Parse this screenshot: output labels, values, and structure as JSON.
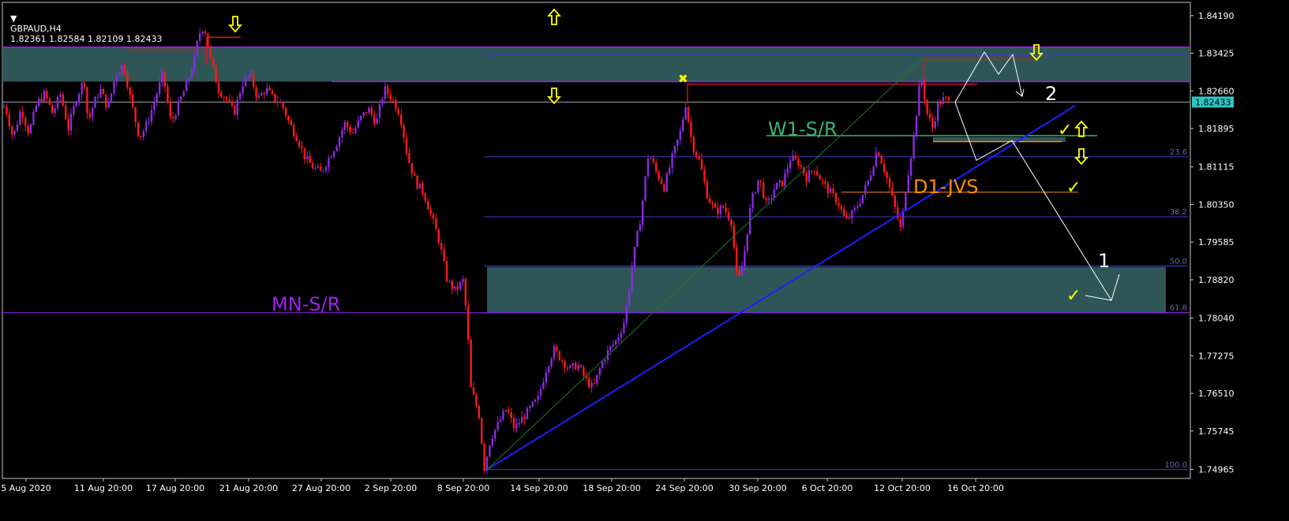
{
  "header": {
    "symbol_tf": "GBPAUD,H4",
    "ohlc": "1.82361 1.82584 1.82109 1.82433"
  },
  "colors": {
    "background": "#000000",
    "axis": "#c8c8c8",
    "bull_candle": "#8a2be2",
    "bear_candle": "#ff1a1a",
    "zone_fill": "#2f5656",
    "trendline": "#1e1eff",
    "fib_line": "#3d3dcc",
    "mn_line": "#a020f0",
    "w1_line": "#3cb371",
    "d1_line": "#ff8c00",
    "resistance_red": "#e01010",
    "arrows": "#ffff00",
    "projection": "#ffffff"
  },
  "chart_data": {
    "type": "candlestick",
    "symbol": "GBPAUD",
    "timeframe": "H4",
    "current_price": 1.82433,
    "ylim": [
      1.7478,
      1.8446
    ],
    "y_ticks": [
      "1.84190",
      "1.83425",
      "1.82660",
      "1.81895",
      "1.81115",
      "1.80350",
      "1.79585",
      "1.78820",
      "1.78040",
      "1.77275",
      "1.76510",
      "1.75745",
      "1.74965"
    ],
    "x_ticks": [
      "5 Aug 2020",
      "11 Aug 20:00",
      "17 Aug 20:00",
      "21 Aug 20:00",
      "27 Aug 20:00",
      "2 Sep 20:00",
      "8 Sep 20:00",
      "14 Sep 20:00",
      "18 Sep 20:00",
      "24 Sep 20:00",
      "30 Sep 20:00",
      "6 Oct 20:00",
      "12 Oct 20:00",
      "16 Oct 20:00"
    ],
    "price_path": [
      [
        0,
        1.823
      ],
      [
        10,
        1.8235
      ],
      [
        20,
        1.817
      ],
      [
        30,
        1.823
      ],
      [
        40,
        1.818
      ],
      [
        50,
        1.824
      ],
      [
        60,
        1.826
      ],
      [
        70,
        1.822
      ],
      [
        80,
        1.826
      ],
      [
        90,
        1.819
      ],
      [
        100,
        1.825
      ],
      [
        110,
        1.829
      ],
      [
        115,
        1.82
      ],
      [
        120,
        1.823
      ],
      [
        130,
        1.827
      ],
      [
        140,
        1.823
      ],
      [
        150,
        1.83
      ],
      [
        160,
        1.832
      ],
      [
        170,
        1.824
      ],
      [
        180,
        1.817
      ],
      [
        190,
        1.82
      ],
      [
        200,
        1.825
      ],
      [
        210,
        1.83
      ],
      [
        220,
        1.82
      ],
      [
        230,
        1.824
      ],
      [
        240,
        1.828
      ],
      [
        250,
        1.833
      ],
      [
        255,
        1.838
      ],
      [
        262,
        1.84
      ],
      [
        270,
        1.833
      ],
      [
        280,
        1.827
      ],
      [
        290,
        1.825
      ],
      [
        300,
        1.822
      ],
      [
        310,
        1.828
      ],
      [
        320,
        1.83
      ],
      [
        330,
        1.825
      ],
      [
        340,
        1.827
      ],
      [
        350,
        1.825
      ],
      [
        360,
        1.824
      ],
      [
        370,
        1.82
      ],
      [
        380,
        1.817
      ],
      [
        390,
        1.813
      ],
      [
        400,
        1.811
      ],
      [
        410,
        1.81
      ],
      [
        420,
        1.813
      ],
      [
        430,
        1.816
      ],
      [
        440,
        1.82
      ],
      [
        450,
        1.818
      ],
      [
        460,
        1.821
      ],
      [
        470,
        1.823
      ],
      [
        480,
        1.82
      ],
      [
        490,
        1.827
      ],
      [
        500,
        1.825
      ],
      [
        510,
        1.822
      ],
      [
        520,
        1.813
      ],
      [
        530,
        1.808
      ],
      [
        540,
        1.806
      ],
      [
        550,
        1.801
      ],
      [
        560,
        1.796
      ],
      [
        570,
        1.788
      ],
      [
        580,
        1.786
      ],
      [
        590,
        1.788
      ],
      [
        595,
        1.78
      ],
      [
        600,
        1.766
      ],
      [
        610,
        1.761
      ],
      [
        617,
        1.75
      ],
      [
        625,
        1.756
      ],
      [
        635,
        1.759
      ],
      [
        645,
        1.762
      ],
      [
        655,
        1.758
      ],
      [
        665,
        1.76
      ],
      [
        675,
        1.762
      ],
      [
        685,
        1.764
      ],
      [
        695,
        1.77
      ],
      [
        705,
        1.774
      ],
      [
        715,
        1.772
      ],
      [
        725,
        1.77
      ],
      [
        735,
        1.771
      ],
      [
        745,
        1.768
      ],
      [
        755,
        1.766
      ],
      [
        765,
        1.771
      ],
      [
        775,
        1.774
      ],
      [
        785,
        1.776
      ],
      [
        795,
        1.78
      ],
      [
        805,
        1.792
      ],
      [
        815,
        1.801
      ],
      [
        825,
        1.814
      ],
      [
        835,
        1.81
      ],
      [
        845,
        1.807
      ],
      [
        855,
        1.813
      ],
      [
        865,
        1.818
      ],
      [
        872,
        1.824
      ],
      [
        880,
        1.816
      ],
      [
        890,
        1.812
      ],
      [
        900,
        1.805
      ],
      [
        910,
        1.802
      ],
      [
        920,
        1.803
      ],
      [
        930,
        1.8
      ],
      [
        938,
        1.787
      ],
      [
        945,
        1.792
      ],
      [
        955,
        1.804
      ],
      [
        965,
        1.809
      ],
      [
        975,
        1.803
      ],
      [
        985,
        1.807
      ],
      [
        995,
        1.808
      ],
      [
        1005,
        1.813
      ],
      [
        1015,
        1.812
      ],
      [
        1025,
        1.809
      ],
      [
        1035,
        1.811
      ],
      [
        1045,
        1.808
      ],
      [
        1055,
        1.806
      ],
      [
        1065,
        1.804
      ],
      [
        1075,
        1.8
      ],
      [
        1085,
        1.802
      ],
      [
        1095,
        1.805
      ],
      [
        1105,
        1.809
      ],
      [
        1115,
        1.815
      ],
      [
        1125,
        1.81
      ],
      [
        1135,
        1.804
      ],
      [
        1145,
        1.798
      ],
      [
        1150,
        1.806
      ],
      [
        1160,
        1.816
      ],
      [
        1170,
        1.83
      ],
      [
        1178,
        1.822
      ],
      [
        1185,
        1.819
      ],
      [
        1192,
        1.824
      ],
      [
        1200,
        1.825
      ],
      [
        1205,
        1.8243
      ]
    ],
    "zones": [
      {
        "name": "upper-zone",
        "from": 1.8285,
        "to": 1.8355
      },
      {
        "name": "lower-zone",
        "from": 1.7815,
        "to": 1.7908
      },
      {
        "name": "small-zone",
        "from": 1.8162,
        "to": 1.8172
      }
    ],
    "fib_levels": [
      {
        "label": "",
        "price": 1.834
      },
      {
        "label": "23.6",
        "price": 1.8132
      },
      {
        "label": "38.2",
        "price": 1.801
      },
      {
        "label": "50.0",
        "price": 1.791
      },
      {
        "label": "61.8",
        "price": 1.7815
      },
      {
        "label": "100.0",
        "price": 1.7496
      }
    ],
    "level_labels": {
      "mn": "MN-S/R",
      "w1": "W1-S/R",
      "d1": "D1-JVS"
    },
    "level_prices": {
      "mn": 1.7815,
      "w1": 1.8175,
      "d1": 1.806,
      "top_line": 1.8285,
      "red_res_1": 1.828,
      "red_res_2": 1.833,
      "red_left": 1.8375
    },
    "projection_labels": [
      "1",
      "2"
    ]
  }
}
